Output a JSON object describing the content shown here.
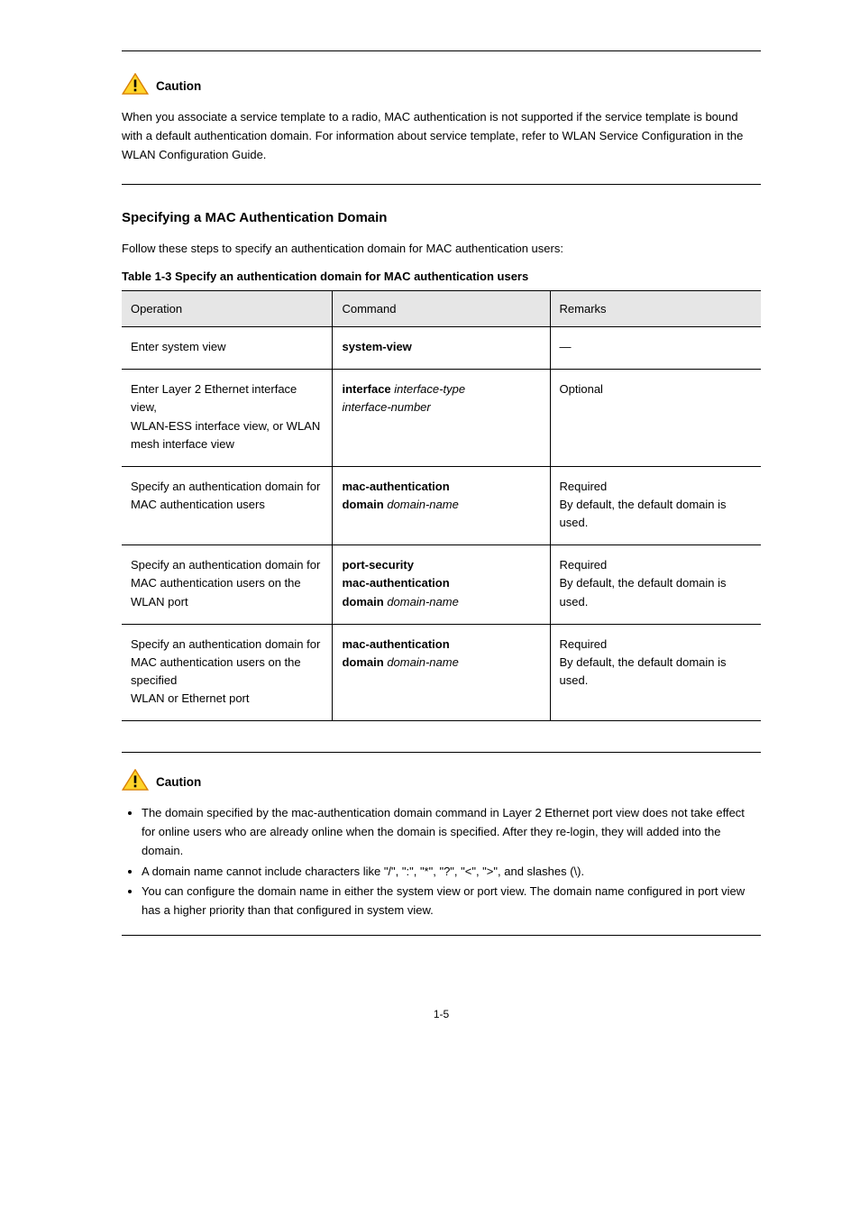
{
  "caution1": {
    "label": "Caution",
    "text": "When you associate a service template to a radio, MAC authentication is not supported if the service template is bound with a default authentication domain. For information about service template, refer to WLAN Service Configuration in the WLAN Configuration Guide."
  },
  "section": {
    "title": "Specifying a MAC Authentication Domain",
    "para": "Follow these steps to specify an authentication domain for MAC authentication users:",
    "caption": "Table 1-3 Specify an authentication domain for MAC authentication users"
  },
  "table": {
    "headers": {
      "op": "Operation",
      "cmd": "Command",
      "rem": "Remarks"
    },
    "rows": [
      {
        "op": "Enter system view",
        "cmd_parts": [
          {
            "b": "system-view"
          }
        ],
        "rem": "—"
      },
      {
        "op": "Enter Layer 2 Ethernet interface view,\nWLAN-ESS interface view, or WLAN mesh interface view",
        "cmd_parts": [
          {
            "b": "interface "
          },
          {
            "i": "interface-type\ninterface-number"
          }
        ],
        "rem": "Optional"
      },
      {
        "op": "Specify an authentication domain for MAC authentication users",
        "cmd_parts": [
          {
            "b": "mac-authentication\ndomain "
          },
          {
            "i": "domain-name"
          }
        ],
        "rem": "Required\nBy default, the default domain is\nused."
      },
      {
        "op": "Specify an authentication domain for MAC authentication users on the WLAN port",
        "cmd_parts": [
          {
            "b": "port-security\nmac-authentication\ndomain "
          },
          {
            "i": "domain-name"
          }
        ],
        "rem": "Required\nBy default, the default domain is\nused."
      },
      {
        "op": "Specify an authentication domain for MAC authentication users on the specified\nWLAN or Ethernet port",
        "cmd_parts": [
          {
            "b": "mac-authentication\ndomain "
          },
          {
            "i": "domain-name"
          }
        ],
        "rem": "Required\nBy default, the default domain is\nused."
      }
    ]
  },
  "caution2": {
    "label": "Caution",
    "bullets": [
      "The domain specified by the mac-authentication domain command in Layer 2 Ethernet port view does not take effect for online users who are already online when the domain is specified. After they re-login, they will added into the domain.",
      "A domain name cannot include characters like \"/\", \":\", \"*\", \"?\", \"<\", \">\", and slashes (\\).",
      "You can configure the domain name in either the system view or port view. The domain name configured in port view has a higher priority than that configured in system view."
    ]
  },
  "pageno": "1-5"
}
